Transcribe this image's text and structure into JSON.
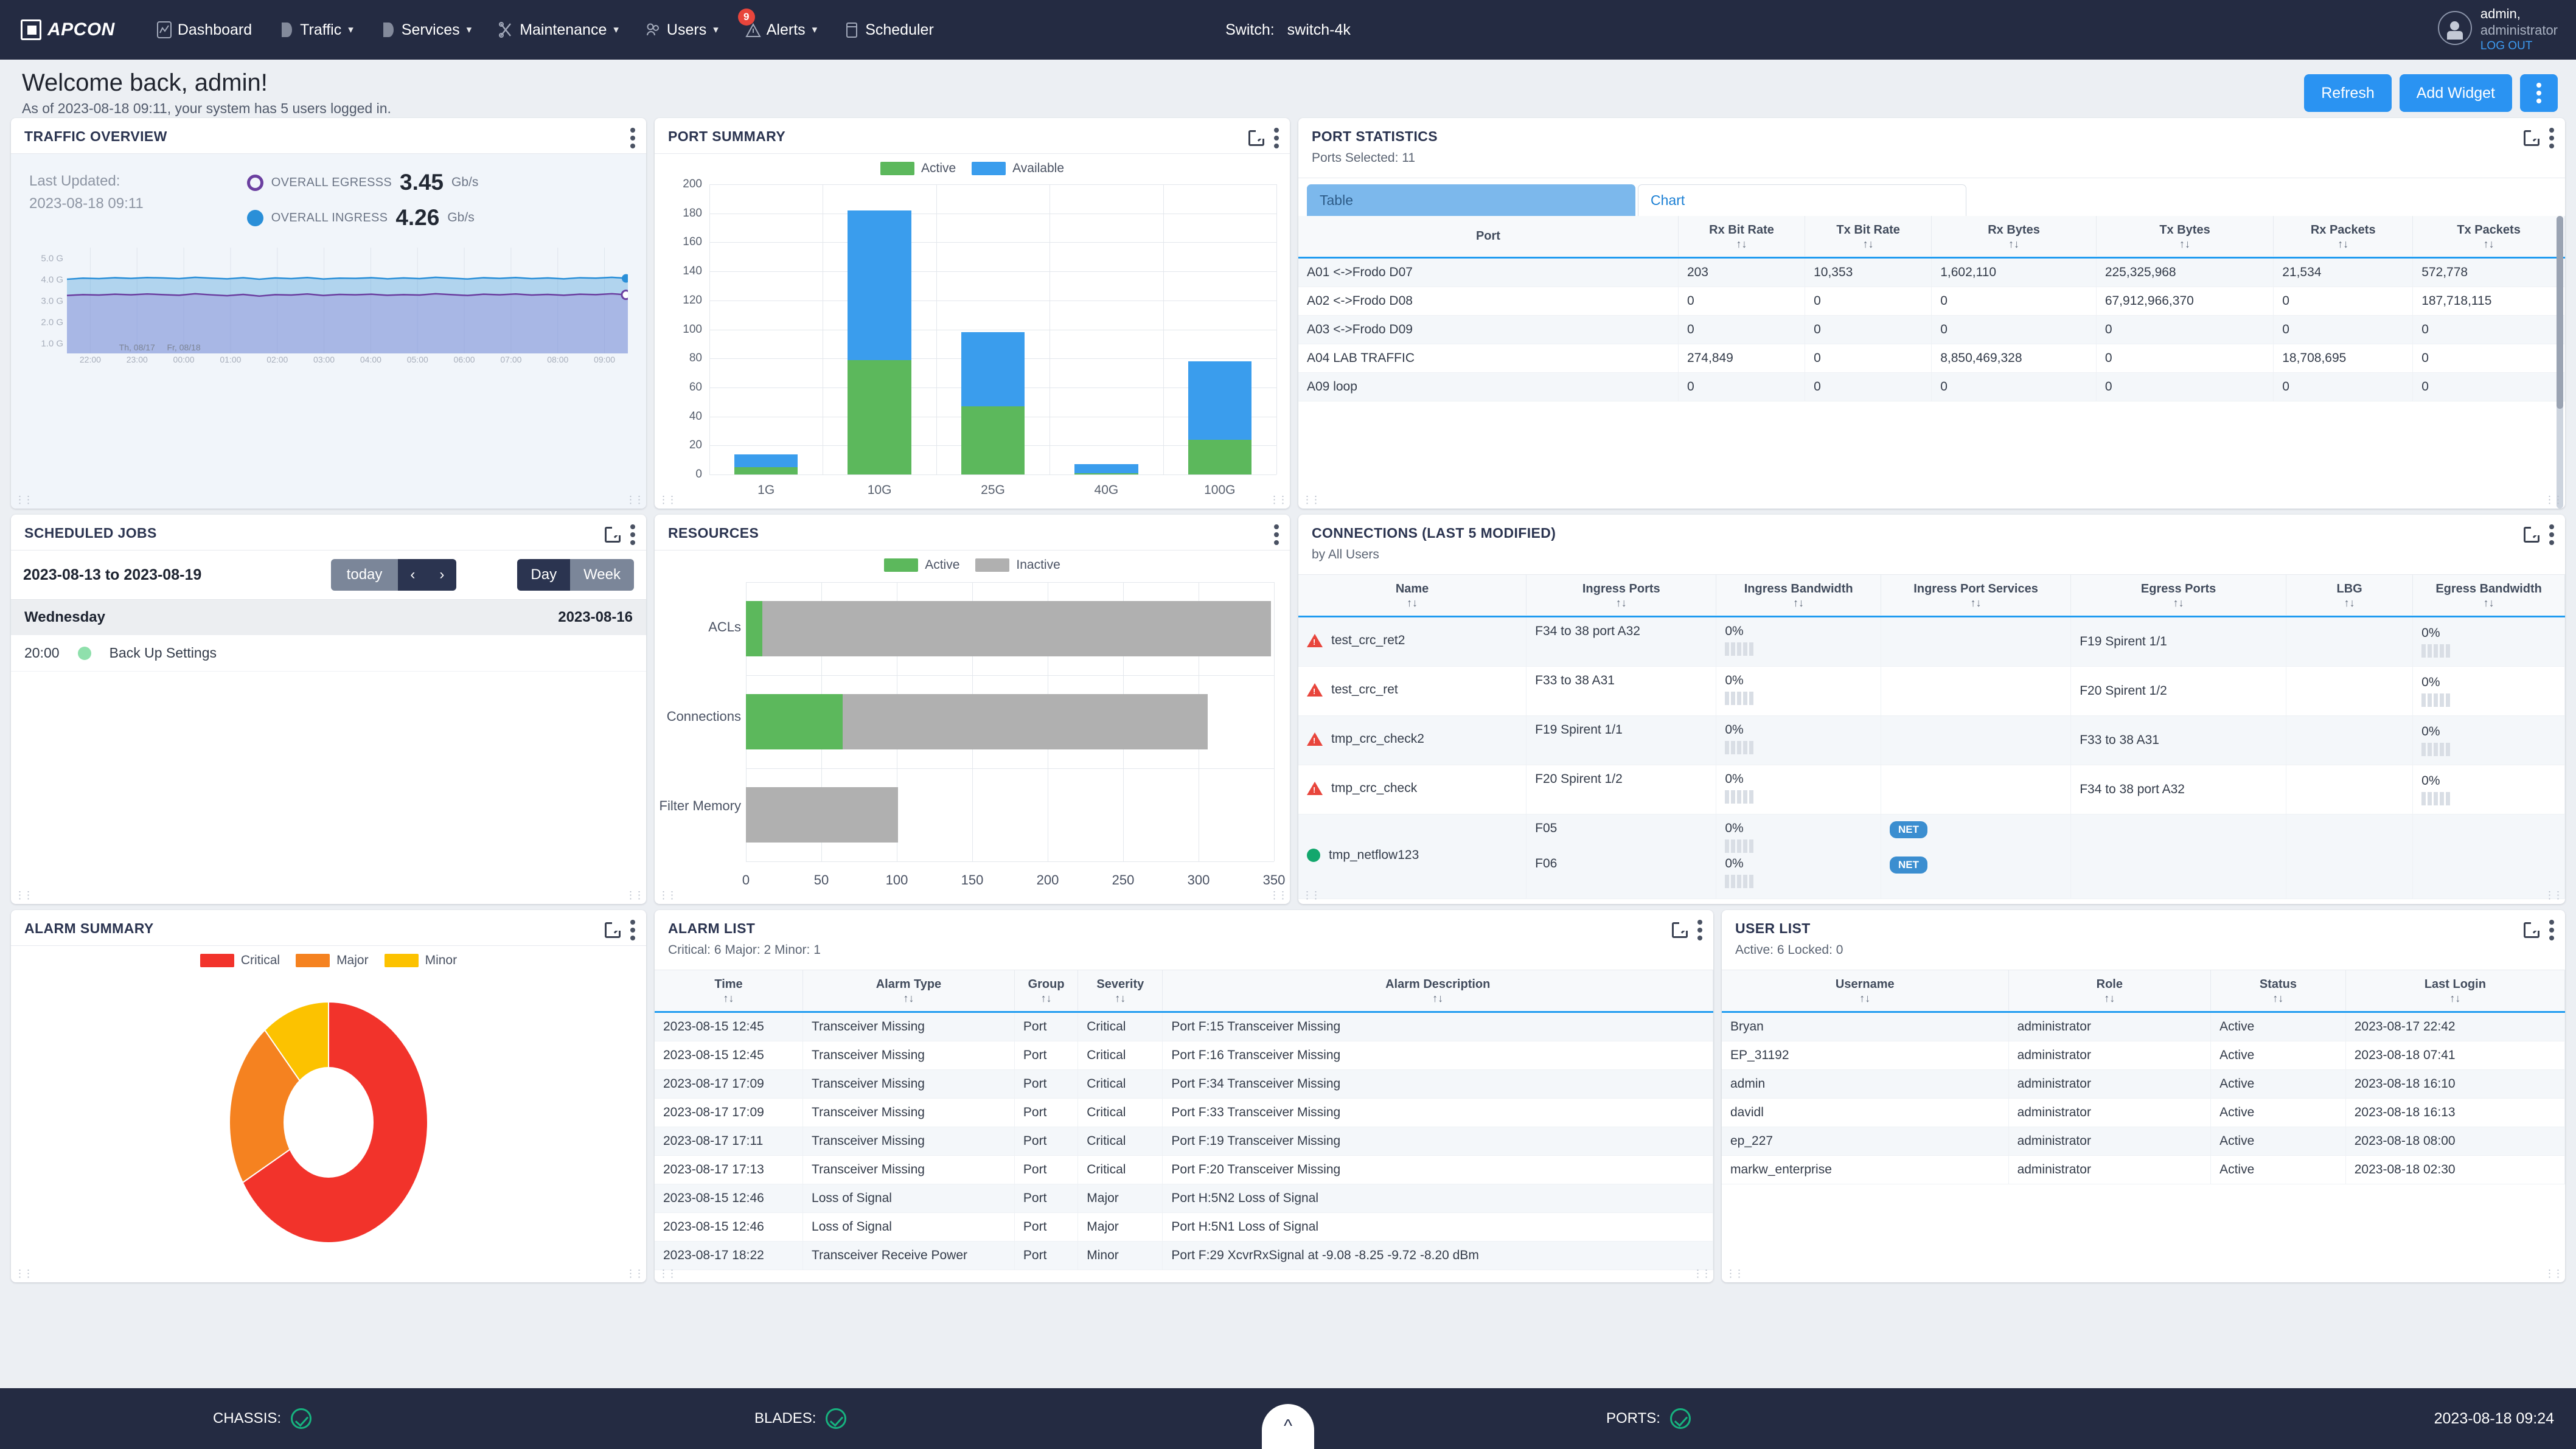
{
  "nav": {
    "logo": "APCON",
    "items": [
      {
        "label": "Dashboard",
        "icon": "dashboard-icon",
        "caret": false
      },
      {
        "label": "Traffic",
        "icon": "traffic-icon",
        "caret": true
      },
      {
        "label": "Services",
        "icon": "services-icon",
        "caret": true
      },
      {
        "label": "Maintenance",
        "icon": "maintenance-icon",
        "caret": true
      },
      {
        "label": "Users",
        "icon": "users-icon",
        "caret": true
      },
      {
        "label": "Alerts",
        "icon": "alerts-icon",
        "caret": true,
        "badge": "9"
      },
      {
        "label": "Scheduler",
        "icon": "scheduler-icon",
        "caret": false
      }
    ],
    "switch_label": "Switch:",
    "switch_value": "switch-4k",
    "user_name": "admin,",
    "user_role": "administrator",
    "logout": "LOG OUT"
  },
  "welcome": {
    "title": "Welcome back, admin!",
    "subtitle": "As of 2023-08-18 09:11, your system has 5 users logged in.",
    "refresh": "Refresh",
    "add_widget": "Add Widget"
  },
  "traffic": {
    "title": "TRAFFIC OVERVIEW",
    "last_updated_label": "Last Updated:",
    "last_updated_value": "2023-08-18 09:11",
    "egress_label": "OVERALL EGRESSS",
    "egress_value": "3.45",
    "egress_unit": "Gb/s",
    "ingress_label": "OVERALL INGRESS",
    "ingress_value": "4.26",
    "ingress_unit": "Gb/s"
  },
  "port_summary": {
    "title": "PORT SUMMARY"
  },
  "port_statistics": {
    "title": "PORT STATISTICS",
    "subtitle": "Ports Selected: 11",
    "tab_table": "Table",
    "tab_chart": "Chart",
    "columns": [
      "Port",
      "Rx Bit Rate",
      "Tx Bit Rate",
      "Rx Bytes",
      "Tx Bytes",
      "Rx Packets",
      "Tx Packets"
    ],
    "rows": [
      [
        "A01  <->Frodo  D07",
        "203",
        "10,353",
        "1,602,110",
        "225,325,968",
        "21,534",
        "572,778"
      ],
      [
        "A02  <->Frodo  D08",
        "0",
        "0",
        "0",
        "67,912,966,370",
        "0",
        "187,718,115"
      ],
      [
        "A03  <->Frodo  D09",
        "0",
        "0",
        "0",
        "0",
        "0",
        "0"
      ],
      [
        "A04  LAB  TRAFFIC",
        "274,849",
        "0",
        "8,850,469,328",
        "0",
        "18,708,695",
        "0"
      ],
      [
        "A09  loop",
        "0",
        "0",
        "0",
        "0",
        "0",
        "0"
      ]
    ]
  },
  "scheduled_jobs": {
    "title": "SCHEDULED JOBS",
    "range": "2023-08-13 to 2023-08-19",
    "today": "today",
    "prev": "‹",
    "next": "›",
    "day": "Day",
    "week": "Week",
    "group_day": "Wednesday",
    "group_date": "2023-08-16",
    "job_time": "20:00",
    "job_name": "Back Up Settings"
  },
  "resources": {
    "title": "RESOURCES"
  },
  "connections": {
    "title": "CONNECTIONS (LAST 5 MODIFIED)",
    "subtitle": "by All Users",
    "columns": [
      "Name",
      "Ingress Ports",
      "Ingress Bandwidth",
      "Ingress Port Services",
      "Egress Ports",
      "LBG",
      "Egress Bandwidth"
    ],
    "rows": [
      {
        "status": "critical",
        "name": "test_crc_ret2",
        "ingress_ports": [
          "F34 to 38 port A32"
        ],
        "ingress_bw": [
          "0%"
        ],
        "services": [
          ""
        ],
        "egress_ports": "F19 Spirent 1/1",
        "lbg": "",
        "egress_bw": "0%"
      },
      {
        "status": "critical",
        "name": "test_crc_ret",
        "ingress_ports": [
          "F33 to 38 A31"
        ],
        "ingress_bw": [
          "0%"
        ],
        "services": [
          ""
        ],
        "egress_ports": "F20 Spirent 1/2",
        "lbg": "",
        "egress_bw": "0%"
      },
      {
        "status": "critical",
        "name": "tmp_crc_check2",
        "ingress_ports": [
          "F19 Spirent 1/1"
        ],
        "ingress_bw": [
          "0%"
        ],
        "services": [
          ""
        ],
        "egress_ports": "F33 to 38 A31",
        "lbg": "",
        "egress_bw": "0%"
      },
      {
        "status": "critical",
        "name": "tmp_crc_check",
        "ingress_ports": [
          "F20 Spirent 1/2"
        ],
        "ingress_bw": [
          "0%"
        ],
        "services": [
          ""
        ],
        "egress_ports": "F34 to 38 port A32",
        "lbg": "",
        "egress_bw": "0%"
      },
      {
        "status": "ok",
        "name": "tmp_netflow123",
        "ingress_ports": [
          "F05",
          "F06"
        ],
        "ingress_bw": [
          "0%",
          "0%"
        ],
        "services": [
          "NET",
          "NET"
        ],
        "egress_ports": "",
        "lbg": "",
        "egress_bw": ""
      }
    ]
  },
  "alarm_summary": {
    "title": "ALARM SUMMARY"
  },
  "alarm_list": {
    "title": "ALARM LIST",
    "subtitle": "Critical: 6 Major: 2 Minor: 1",
    "columns": [
      "Time",
      "Alarm Type",
      "Group",
      "Severity",
      "Alarm Description"
    ],
    "rows": [
      [
        "2023-08-15 12:45",
        "Transceiver Missing",
        "Port",
        "Critical",
        "Port F:15 Transceiver Missing"
      ],
      [
        "2023-08-15 12:45",
        "Transceiver Missing",
        "Port",
        "Critical",
        "Port F:16 Transceiver Missing"
      ],
      [
        "2023-08-17 17:09",
        "Transceiver Missing",
        "Port",
        "Critical",
        "Port F:34 Transceiver Missing"
      ],
      [
        "2023-08-17 17:09",
        "Transceiver Missing",
        "Port",
        "Critical",
        "Port F:33 Transceiver Missing"
      ],
      [
        "2023-08-17 17:11",
        "Transceiver Missing",
        "Port",
        "Critical",
        "Port F:19 Transceiver Missing"
      ],
      [
        "2023-08-17 17:13",
        "Transceiver Missing",
        "Port",
        "Critical",
        "Port F:20 Transceiver Missing"
      ],
      [
        "2023-08-15 12:46",
        "Loss of Signal",
        "Port",
        "Major",
        "Port H:5N2 Loss of Signal"
      ],
      [
        "2023-08-15 12:46",
        "Loss of Signal",
        "Port",
        "Major",
        "Port H:5N1 Loss of Signal"
      ],
      [
        "2023-08-17 18:22",
        "Transceiver Receive Power",
        "Port",
        "Minor",
        "Port F:29 XcvrRxSignal at -9.08 -8.25 -9.72 -8.20 dBm"
      ]
    ]
  },
  "user_list": {
    "title": "USER LIST",
    "subtitle": "Active: 6 Locked: 0",
    "columns": [
      "Username",
      "Role",
      "Status",
      "Last Login"
    ],
    "rows": [
      [
        "Bryan",
        "administrator",
        "Active",
        "2023-08-17 22:42"
      ],
      [
        "EP_31192",
        "administrator",
        "Active",
        "2023-08-18 07:41"
      ],
      [
        "admin",
        "administrator",
        "Active",
        "2023-08-18 16:10"
      ],
      [
        "davidl",
        "administrator",
        "Active",
        "2023-08-18 16:13"
      ],
      [
        "ep_227",
        "administrator",
        "Active",
        "2023-08-18 08:00"
      ],
      [
        "markw_enterprise",
        "administrator",
        "Active",
        "2023-08-18 02:30"
      ]
    ]
  },
  "footer": {
    "chassis_label": "CHASSIS:",
    "blades_label": "BLADES:",
    "ports_label": "PORTS:",
    "timestamp": "2023-08-18  09:24"
  },
  "colors": {
    "accent": "#2a93f2",
    "nav_bg": "#242b42",
    "active_green": "#5cb85c",
    "available_blue": "#3a9ded",
    "inactive_gray": "#b0b0b0",
    "critical": "#f2332b",
    "major": "#f58220",
    "minor": "#fcc200",
    "egress_purple": "#6b3fa0",
    "ingress_blue": "#2a8fd8"
  },
  "chart_data": [
    {
      "type": "area",
      "id": "traffic-overview",
      "title": "TRAFFIC OVERVIEW",
      "ylabel": "",
      "xlabel": "",
      "ytick_labels": [
        "1.0 G",
        "2.0 G",
        "3.0 G",
        "4.0 G",
        "5.0 G"
      ],
      "ylim": [
        0,
        5.5
      ],
      "xtick_labels": [
        "22:00",
        "23:00",
        "00:00",
        "01:00",
        "02:00",
        "03:00",
        "04:00",
        "05:00",
        "06:00",
        "07:00",
        "08:00",
        "09:00"
      ],
      "day_markers": [
        "Th, 08/17",
        "Fr, 08/18"
      ],
      "grid": true,
      "legend": "inline-metrics",
      "series": [
        {
          "name": "Overall Ingress",
          "color": "#2a8fd8",
          "current": 4.26,
          "values": [
            4.02,
            4.07,
            4.05,
            4.09,
            4.06,
            4.1,
            4.08,
            4.05,
            4.11,
            4.07,
            4.04,
            4.09,
            4.02,
            4.08,
            4.05,
            4.1,
            4.03,
            4.07,
            4.06,
            4.09,
            4.04,
            4.08,
            4.05,
            4.11,
            4.07,
            4.03,
            4.09,
            4.06,
            4.1,
            4.05,
            4.08,
            4.04,
            4.09,
            4.07,
            4.11,
            4.06
          ]
        },
        {
          "name": "Overall Egress",
          "color": "#6b3fa0",
          "current": 3.45,
          "values": [
            3.26,
            3.3,
            3.28,
            3.32,
            3.29,
            3.33,
            3.3,
            3.27,
            3.34,
            3.29,
            3.25,
            3.31,
            3.23,
            3.3,
            3.28,
            3.33,
            3.26,
            3.31,
            3.29,
            3.32,
            3.27,
            3.3,
            3.28,
            3.34,
            3.3,
            3.26,
            3.32,
            3.29,
            3.33,
            3.28,
            3.31,
            3.27,
            3.32,
            3.3,
            3.34,
            3.29
          ]
        }
      ]
    },
    {
      "type": "bar",
      "id": "port-summary",
      "title": "PORT SUMMARY",
      "stacked": true,
      "categories": [
        "1G",
        "10G",
        "25G",
        "40G",
        "100G"
      ],
      "series": [
        {
          "name": "Active",
          "color": "#5cb85c",
          "values": [
            5,
            79,
            47,
            1,
            24
          ]
        },
        {
          "name": "Available",
          "color": "#3a9ded",
          "values": [
            9,
            103,
            51,
            6,
            54
          ]
        }
      ],
      "ylim": [
        0,
        200
      ],
      "yticks": [
        0,
        20,
        40,
        60,
        80,
        100,
        120,
        140,
        160,
        180,
        200
      ],
      "xlabel": "",
      "ylabel": "",
      "grid": true,
      "legend": "top"
    },
    {
      "type": "bar",
      "id": "resources",
      "title": "RESOURCES",
      "orientation": "horizontal",
      "stacked": true,
      "categories": [
        "ACLs",
        "Connections",
        "Filter Memory"
      ],
      "series": [
        {
          "name": "Active",
          "color": "#5cb85c",
          "values": [
            11,
            64,
            0
          ]
        },
        {
          "name": "Inactive",
          "color": "#b0b0b0",
          "values": [
            337,
            242,
            101
          ]
        }
      ],
      "xlim": [
        0,
        350
      ],
      "xticks": [
        0,
        50,
        100,
        150,
        200,
        250,
        300,
        350
      ],
      "xlabel": "",
      "ylabel": "",
      "grid": true,
      "legend": "top"
    },
    {
      "type": "pie",
      "id": "alarm-summary",
      "title": "ALARM SUMMARY",
      "donut": true,
      "labels": [
        "Critical",
        "Major",
        "Minor"
      ],
      "values": [
        6,
        2,
        1
      ],
      "colors": [
        "#f2332b",
        "#f58220",
        "#fcc200"
      ],
      "legend": "top"
    }
  ]
}
